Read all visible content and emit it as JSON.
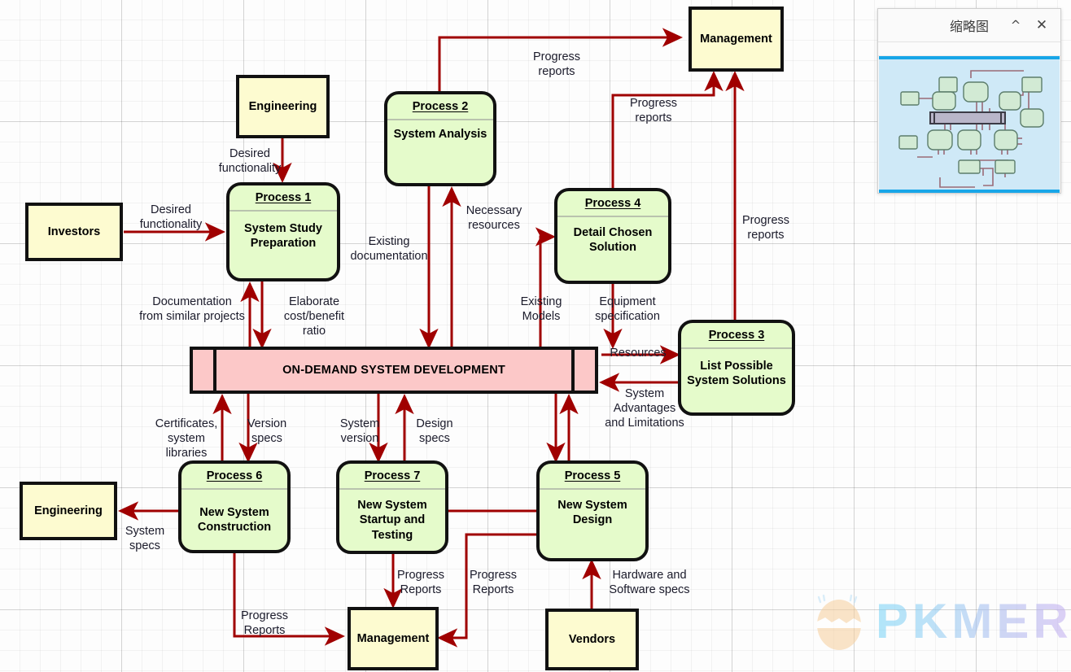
{
  "diagram": {
    "title": "ON-DEMAND SYSTEM DEVELOPMENT",
    "colors": {
      "external_fill": "#fdfbd0",
      "process_fill": "#e5fbcb",
      "store_fill": "#fcc8c8",
      "edge": "#a00000",
      "border": "#111111"
    },
    "store": {
      "label": "ON-DEMAND SYSTEM DEVELOPMENT"
    },
    "externals": [
      {
        "id": "investors",
        "label": "Investors"
      },
      {
        "id": "engineering_top",
        "label": "Engineering"
      },
      {
        "id": "management_top",
        "label": "Management"
      },
      {
        "id": "engineering_bot",
        "label": "Engineering"
      },
      {
        "id": "management_bot",
        "label": "Management"
      },
      {
        "id": "vendors",
        "label": "Vendors"
      }
    ],
    "processes": [
      {
        "id": "p1",
        "header": "Process 1",
        "body": "System Study\nPreparation"
      },
      {
        "id": "p2",
        "header": "Process 2",
        "body": "System Analysis"
      },
      {
        "id": "p3",
        "header": "Process 3",
        "body": "List Possible\nSystem Solutions"
      },
      {
        "id": "p4",
        "header": "Process 4",
        "body": "Detail Chosen\nSolution"
      },
      {
        "id": "p5",
        "header": "Process 5",
        "body": "New System\nDesign"
      },
      {
        "id": "p6",
        "header": "Process 6",
        "body": "New\nSystem\nConstruction"
      },
      {
        "id": "p7",
        "header": "Process 7",
        "body": "New System\nStartup and\nTesting"
      }
    ],
    "edge_labels": [
      {
        "id": "e1",
        "text": "Desired\nfunctionality"
      },
      {
        "id": "e2",
        "text": "Desired\nfunctionality"
      },
      {
        "id": "e3",
        "text": "Progress\nreports"
      },
      {
        "id": "e4",
        "text": "Progress\nreports"
      },
      {
        "id": "e5",
        "text": "Progress\nreports"
      },
      {
        "id": "e6",
        "text": "Existing\ndocumentation"
      },
      {
        "id": "e7",
        "text": "Necessary\nresources"
      },
      {
        "id": "e8",
        "text": "Documentation\nfrom similar projects"
      },
      {
        "id": "e9",
        "text": "Elaborate\ncost/benefit\nratio"
      },
      {
        "id": "e10",
        "text": "Existing\nModels"
      },
      {
        "id": "e11",
        "text": "Equipment\nspecification"
      },
      {
        "id": "e12",
        "text": "Resources"
      },
      {
        "id": "e13",
        "text": "System\nAdvantages\nand Limitations"
      },
      {
        "id": "e14",
        "text": "Certificates,\nsystem\nlibraries"
      },
      {
        "id": "e15",
        "text": "Version\nspecs"
      },
      {
        "id": "e16",
        "text": "System\nversion"
      },
      {
        "id": "e17",
        "text": "Design\nspecs"
      },
      {
        "id": "e18",
        "text": "System\nspecs"
      },
      {
        "id": "e19",
        "text": "Progress\nReports"
      },
      {
        "id": "e20",
        "text": "Progress\nReports"
      },
      {
        "id": "e21",
        "text": "Progress\nReports"
      },
      {
        "id": "e22",
        "text": "Hardware and\nSoftware specs"
      }
    ]
  },
  "minimap": {
    "title": "缩略图",
    "collapse_icon": "^",
    "close_icon": "✕"
  },
  "watermark": {
    "text": "PKMER"
  }
}
